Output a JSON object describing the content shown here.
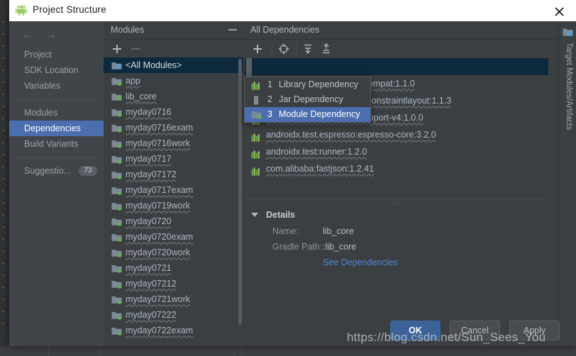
{
  "window": {
    "title": "Project Structure",
    "app_icon": "android-robot-icon",
    "close_icon": "close-icon"
  },
  "nav": {
    "back_icon": "arrow-left-icon",
    "forward_icon": "arrow-right-icon",
    "groups": [
      {
        "items": [
          {
            "label": "Project",
            "selected": false
          },
          {
            "label": "SDK Location",
            "selected": false
          },
          {
            "label": "Variables",
            "selected": false
          }
        ]
      },
      {
        "items": [
          {
            "label": "Modules",
            "selected": false
          },
          {
            "label": "Dependencies",
            "selected": true
          },
          {
            "label": "Build Variants",
            "selected": false
          }
        ]
      },
      {
        "items": [
          {
            "label": "Suggestio...",
            "selected": false,
            "badge": "73"
          }
        ]
      }
    ]
  },
  "modules_panel": {
    "title": "Modules",
    "collapse_icon": "minus-icon",
    "add_icon": "plus-icon",
    "remove_icon": "minus-icon",
    "items": [
      {
        "label": "<All Modules>",
        "icon": "all-modules-icon",
        "selected": true,
        "wavy": false
      },
      {
        "label": "app",
        "icon": "module-folder-icon",
        "selected": false,
        "wavy": true
      },
      {
        "label": "lib_core",
        "icon": "library-folder-icon",
        "selected": false,
        "wavy": true
      },
      {
        "label": "myday0716",
        "icon": "module-folder-icon",
        "selected": false,
        "wavy": true
      },
      {
        "label": "myday0716exam",
        "icon": "module-folder-icon",
        "selected": false,
        "wavy": true
      },
      {
        "label": "myday0716work",
        "icon": "module-folder-icon",
        "selected": false,
        "wavy": true
      },
      {
        "label": "myday0717",
        "icon": "module-folder-icon",
        "selected": false,
        "wavy": true
      },
      {
        "label": "myday07172",
        "icon": "module-folder-icon",
        "selected": false,
        "wavy": true
      },
      {
        "label": "myday0717exam",
        "icon": "module-folder-icon",
        "selected": false,
        "wavy": true
      },
      {
        "label": "myday0719work",
        "icon": "module-folder-icon",
        "selected": false,
        "wavy": true
      },
      {
        "label": "myday0720",
        "icon": "module-folder-icon",
        "selected": false,
        "wavy": true
      },
      {
        "label": "myday0720exam",
        "icon": "module-folder-icon",
        "selected": false,
        "wavy": true
      },
      {
        "label": "myday0720work",
        "icon": "module-folder-icon",
        "selected": false,
        "wavy": true
      },
      {
        "label": "myday0721",
        "icon": "module-folder-icon",
        "selected": false,
        "wavy": true
      },
      {
        "label": "myday07212",
        "icon": "module-folder-icon",
        "selected": false,
        "wavy": true
      },
      {
        "label": "myday0721work",
        "icon": "module-folder-icon",
        "selected": false,
        "wavy": true
      },
      {
        "label": "myday07222",
        "icon": "module-folder-icon",
        "selected": false,
        "wavy": true
      },
      {
        "label": "myday0722exam",
        "icon": "module-folder-icon",
        "selected": false,
        "wavy": true
      }
    ]
  },
  "dependencies_panel": {
    "title": "All Dependencies",
    "toolbar": [
      {
        "icon": "plus-icon",
        "name": "add-dependency-button"
      },
      {
        "icon": "scope-target-icon",
        "name": "scope-button"
      },
      {
        "icon": "move-down-icon",
        "name": "move-down-button"
      },
      {
        "icon": "move-up-icon",
        "name": "move-up-button"
      }
    ],
    "items": [
      {
        "label": "",
        "icon": "",
        "selected": true,
        "wavy": false
      },
      {
        "label": "androidx.appcompat:appcompat:1.1.0",
        "icon": "library-icon",
        "selected": false,
        "wavy": true
      },
      {
        "label": "androidx.constraintlayout:constraintlayout:1.1.3",
        "icon": "library-icon",
        "selected": false,
        "wavy": true
      },
      {
        "label": "androidx.legacy:legacy-support-v4:1.0.0",
        "icon": "library-icon",
        "selected": false,
        "wavy": true
      },
      {
        "label": "androidx.test.espresso:espresso-core:3.2.0",
        "icon": "library-icon",
        "selected": false,
        "wavy": true
      },
      {
        "label": "androidx.test:runner:1.2.0",
        "icon": "library-icon",
        "selected": false,
        "wavy": true
      },
      {
        "label": "com.alibaba:fastjson:1.2.41",
        "icon": "library-icon",
        "selected": false,
        "wavy": true
      }
    ]
  },
  "details": {
    "title": "Details",
    "expand_icon": "triangle-down-icon",
    "rows": [
      {
        "key": "Name:",
        "value": "lib_core",
        "link": false
      },
      {
        "key": "Gradle Path:",
        "value": ":lib_core",
        "link": false
      },
      {
        "key": "",
        "value": "See Dependencies",
        "link": true
      }
    ]
  },
  "right_strip": {
    "icon": "target-modules-icon",
    "label": "Target Modules/Artifacts"
  },
  "dropdown_menu": {
    "items": [
      {
        "num": "1",
        "label": "Library Dependency",
        "icon": "library-icon",
        "selected": false
      },
      {
        "num": "2",
        "label": "Jar Dependency",
        "icon": "jar-icon",
        "selected": false
      },
      {
        "num": "3",
        "label": "Module Dependency",
        "icon": "module-folder-icon",
        "selected": true
      }
    ]
  },
  "buttons": {
    "ok": "OK",
    "cancel": "Cancel",
    "apply": "Apply"
  },
  "watermark": "https://blog.csdn.net/Sun_Sees_You",
  "colors": {
    "accent_selected": "#4b6eaf",
    "row_selected": "#0d293e",
    "link": "#4a86d8",
    "panel_bg": "#3c3f41",
    "nav_bg": "#41454a",
    "primary_button": "#3c6399"
  },
  "background_editor": {
    "code_marks": [
      "-",
      "-",
      "-",
      "-",
      "-",
      "-",
      "-",
      "-",
      "-",
      "-",
      "-",
      "-",
      "-",
      "-",
      "-",
      "-",
      "-",
      "-",
      "-",
      "-",
      "-",
      "-",
      "-",
      "-",
      "-",
      "-"
    ]
  },
  "statusbar": {
    "left": "",
    "mid": "",
    "right": ""
  }
}
